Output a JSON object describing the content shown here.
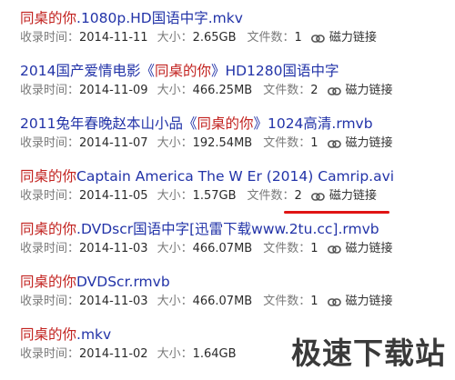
{
  "results": [
    {
      "title_parts": [
        {
          "text": "同桌的你",
          "hl": true
        },
        {
          "text": ".1080p.HD国语中字.mkv",
          "hl": false
        }
      ],
      "date_label": "收录时间：",
      "date": "2014-11-11",
      "size_label": "大小：",
      "size": "2.65GB",
      "files_label": "文件数：",
      "files": "1",
      "magnet_label": "磁力链接"
    },
    {
      "title_parts": [
        {
          "text": "2014国产爱情电影《",
          "hl": false
        },
        {
          "text": "同桌的你",
          "hl": true
        },
        {
          "text": "》HD1280国语中字",
          "hl": false
        }
      ],
      "date_label": "收录时间：",
      "date": "2014-11-09",
      "size_label": "大小：",
      "size": "466.25MB",
      "files_label": "文件数：",
      "files": "2",
      "magnet_label": "磁力链接"
    },
    {
      "title_parts": [
        {
          "text": "2011兔年春晚赵本山小品《",
          "hl": false
        },
        {
          "text": "同桌的你",
          "hl": true
        },
        {
          "text": "》1024高清.rmvb",
          "hl": false
        }
      ],
      "date_label": "收录时间：",
      "date": "2014-11-07",
      "size_label": "大小：",
      "size": "192.54MB",
      "files_label": "文件数：",
      "files": "1",
      "magnet_label": "磁力链接"
    },
    {
      "title_parts": [
        {
          "text": "同桌的你",
          "hl": true
        },
        {
          "text": "Captain America The W Er (2014) Camrip.avi",
          "hl": false
        }
      ],
      "date_label": "收录时间：",
      "date": "2014-11-05",
      "size_label": "大小：",
      "size": "1.57GB",
      "files_label": "文件数：",
      "files": "2",
      "magnet_label": "磁力链接"
    },
    {
      "title_parts": [
        {
          "text": "同桌的你",
          "hl": true
        },
        {
          "text": ".DVDscr国语中字[迅雷下载www.2tu.cc].rmvb",
          "hl": false
        }
      ],
      "date_label": "收录时间：",
      "date": "2014-11-03",
      "size_label": "大小：",
      "size": "466.07MB",
      "files_label": "文件数：",
      "files": "1",
      "magnet_label": "磁力链接"
    },
    {
      "title_parts": [
        {
          "text": "同桌的你",
          "hl": true
        },
        {
          "text": "DVDScr.rmvb",
          "hl": false
        }
      ],
      "date_label": "收录时间：",
      "date": "2014-11-03",
      "size_label": "大小：",
      "size": "466.07MB",
      "files_label": "文件数：",
      "files": "1",
      "magnet_label": "磁力链接"
    },
    {
      "title_parts": [
        {
          "text": "同桌的你",
          "hl": true
        },
        {
          "text": ".mkv",
          "hl": false
        }
      ],
      "date_label": "收录时间：",
      "date": "2014-11-02",
      "size_label": "大小：",
      "size": "1.64GB",
      "files_label": "",
      "files": "",
      "magnet_label": ""
    }
  ],
  "watermark": "极速下载站",
  "colors": {
    "title": "#2233a8",
    "highlight": "#c2221f",
    "annotation": "#e01414"
  },
  "icons": {
    "magnet": "link-icon"
  }
}
